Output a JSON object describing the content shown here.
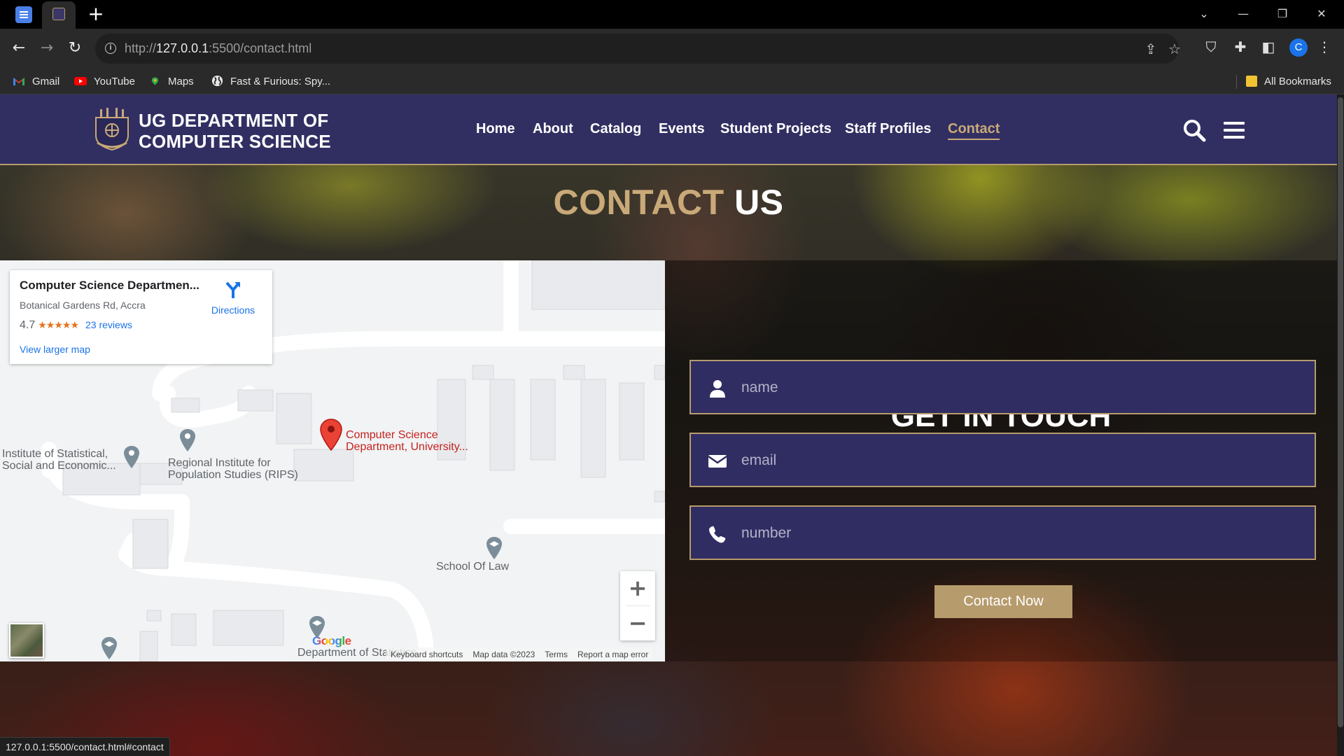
{
  "browser": {
    "address_scheme": "http://",
    "address_host": "127.0.0.1",
    "address_rest": ":5500/contact.html",
    "bookmarks": [
      {
        "label": "Gmail"
      },
      {
        "label": "YouTube"
      },
      {
        "label": "Maps"
      },
      {
        "label": "Fast & Furious: Spy..."
      }
    ],
    "all_bookmarks": "All Bookmarks",
    "profile_initial": "C",
    "status_url": "127.0.0.1:5500/contact.html#contact"
  },
  "header": {
    "brand_line1": "UG DEPARTMENT OF",
    "brand_line2": "COMPUTER SCIENCE",
    "nav": [
      {
        "label": "Home"
      },
      {
        "label": "About"
      },
      {
        "label": "Catalog"
      },
      {
        "label": "Events"
      },
      {
        "label": "Student Projects"
      },
      {
        "label": "Staff Profiles"
      },
      {
        "label": "Contact",
        "active": true
      }
    ]
  },
  "page": {
    "heading_part1": "CONTACT",
    "heading_part2": "US"
  },
  "map": {
    "place_name": "Computer Science Departmen...",
    "address": "Botanical Gardens Rd, Accra",
    "rating": "4.7",
    "reviews": "23 reviews",
    "directions": "Directions",
    "view_larger": "View larger map",
    "marker_label_line1": "Computer Science",
    "marker_label_line2": "Department, University...",
    "places": [
      {
        "line1": "Institute of Statistical,",
        "line2": "Social and Economic..."
      },
      {
        "line1": "Regional Institute for",
        "line2": "Population Studies (RIPS)"
      },
      {
        "line1": "School Of Law",
        "line2": ""
      },
      {
        "line1": "Department of Statistics",
        "line2": ""
      }
    ],
    "google_logo": "Google",
    "attribution": {
      "shortcuts": "Keyboard shortcuts",
      "data": "Map data ©2023",
      "terms": "Terms",
      "report": "Report a map error"
    }
  },
  "form": {
    "title": "GET IN TOUCH",
    "name_placeholder": "name",
    "email_placeholder": "email",
    "number_placeholder": "number",
    "submit_label": "Contact Now"
  },
  "colors": {
    "brand_purple": "#312f62",
    "accent_gold": "#b69b6c"
  }
}
